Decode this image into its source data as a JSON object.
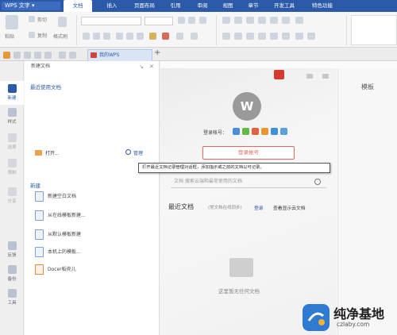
{
  "app": {
    "title": "WPS 文字",
    "dropdown": "▾"
  },
  "menu": [
    "文档",
    "插入",
    "页面布局",
    "引用",
    "审阅",
    "视图",
    "章节",
    "开发工具",
    "特色功能"
  ],
  "ribbon": {
    "groups": [
      {
        "label": "粘贴"
      },
      {
        "label": "剪切"
      },
      {
        "label": "复制"
      },
      {
        "label": "格式刷"
      }
    ]
  },
  "tab": {
    "doc_name": "我的WPS",
    "add": "+"
  },
  "rail": [
    {
      "label": "新建"
    },
    {
      "label": "样式"
    },
    {
      "label": "选择"
    },
    {
      "label": "限制"
    },
    {
      "label": "分享"
    },
    {
      "label": "反馈"
    },
    {
      "label": "备份"
    },
    {
      "label": "工具"
    }
  ],
  "panel": {
    "title": "新建文档",
    "recent_header": "最近使用文档",
    "open": "打开...",
    "manage": "管理",
    "new_header": "新建",
    "items": [
      {
        "label": "新建空白文档"
      },
      {
        "label": "从在线模板新建..."
      },
      {
        "label": "从默认模板新建"
      },
      {
        "label": "本机上的模板..."
      },
      {
        "label": "Docer稻壳儿"
      }
    ]
  },
  "main": {
    "quick_login_label": "登录帐号：",
    "login_button": "登录帐号",
    "search_placeholder": "文档  搜索云端和最常使用的文档",
    "recent_title": "最近文档",
    "recent_sub": "(常文档在线同步)",
    "login_link": "登录",
    "login_link2": "查看显示云文档",
    "empty_text": "这里暂无任何文档",
    "right_title": "模板"
  },
  "tooltip": "打开最近文档记录管理对话框，添加指示或之前的文档以可记录。",
  "watermark": {
    "title": "纯净基地",
    "url": "czlaby.com"
  },
  "colors": {
    "brand": "#2b5aa8",
    "login": "#e06a5c",
    "ribbon_bg": "#f6f6f6"
  }
}
